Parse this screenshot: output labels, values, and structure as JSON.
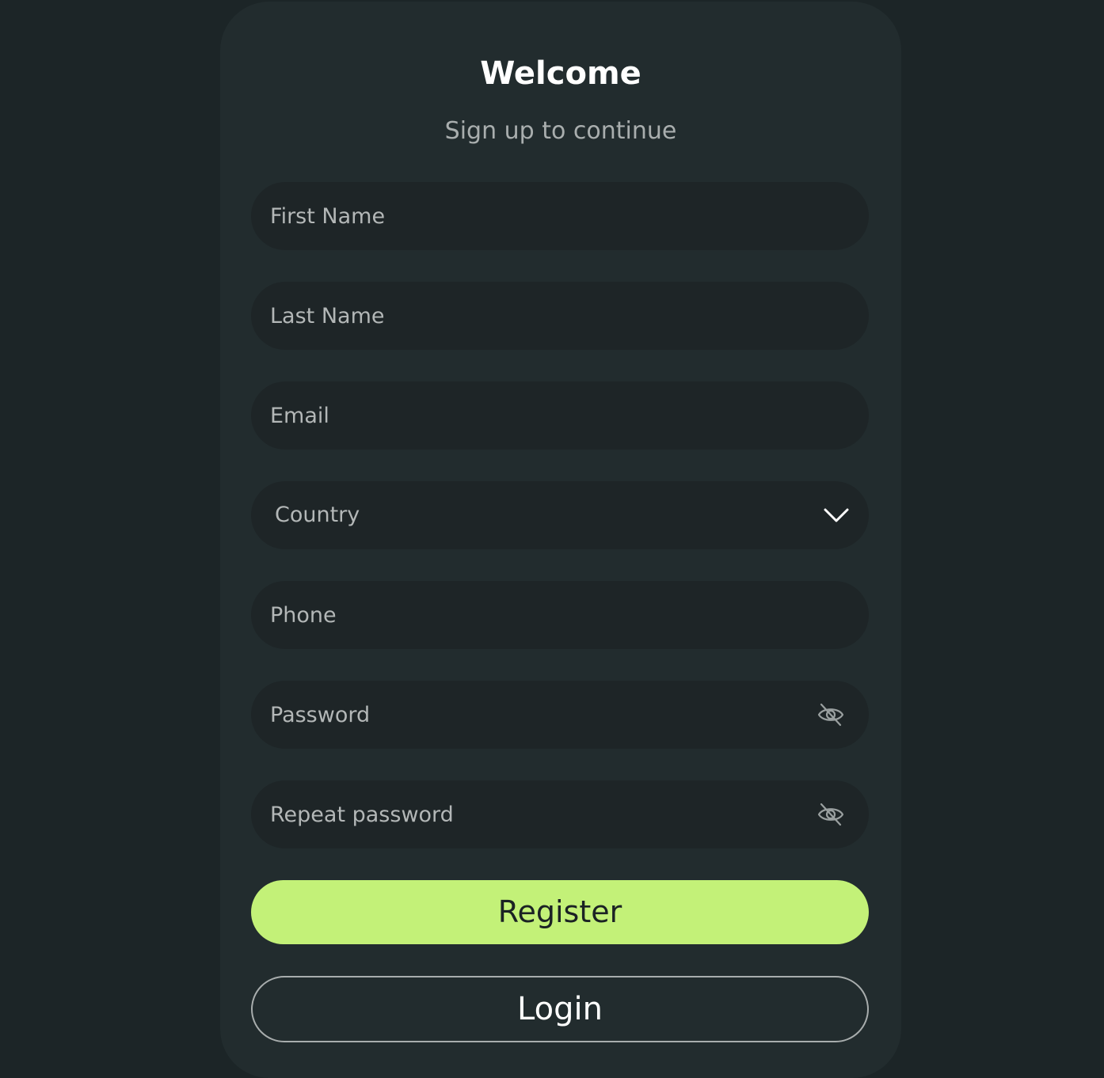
{
  "form": {
    "title": "Welcome",
    "subtitle": "Sign up to continue",
    "first_name": {
      "placeholder": "First Name",
      "value": ""
    },
    "last_name": {
      "placeholder": "Last Name",
      "value": ""
    },
    "email": {
      "placeholder": "Email",
      "value": ""
    },
    "country": {
      "selected": "Country",
      "icon": "chevron-down-icon"
    },
    "phone": {
      "placeholder": "Phone",
      "value": ""
    },
    "password": {
      "placeholder": "Password",
      "value": "",
      "icon": "eye-off-icon"
    },
    "repeat_password": {
      "placeholder": "Repeat password",
      "value": "",
      "icon": "eye-off-icon"
    },
    "register_label": "Register",
    "login_label": "Login"
  },
  "colors": {
    "background": "#1c2527",
    "card": "#222c2e",
    "field": "#1e2527",
    "accent": "#c3f178",
    "placeholder": "#b3b7b7"
  }
}
